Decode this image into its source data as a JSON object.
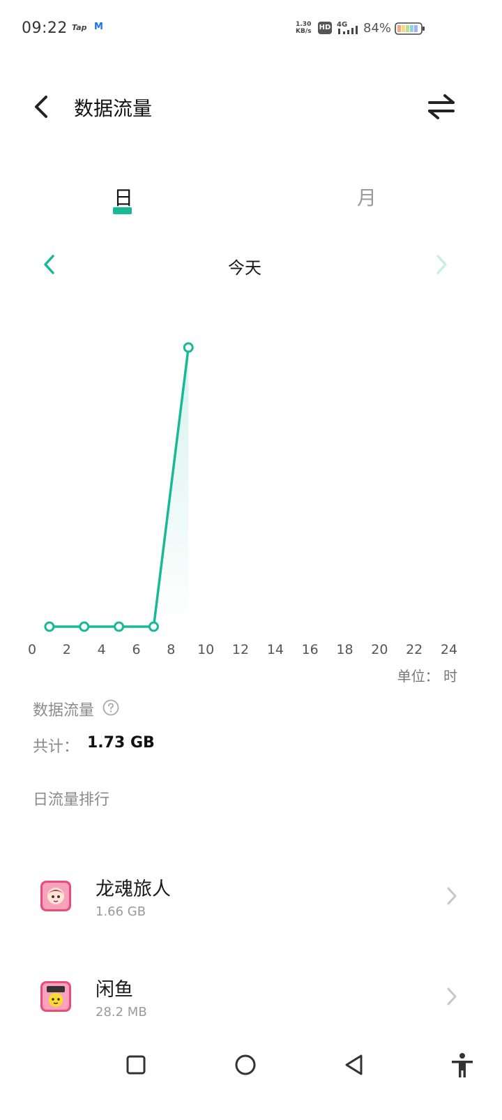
{
  "status_bar": {
    "time": "09:22",
    "app_indicators": [
      "Tap",
      "M"
    ],
    "net_speed_value": "1.30",
    "net_speed_unit": "KB/s",
    "hd_badge": "HD",
    "network": "4G",
    "battery_percent": "84%",
    "battery_level": 0.84
  },
  "header": {
    "title": "数据流量",
    "back_icon": "chevron-left-icon",
    "switch_icon": "swap-arrows-icon"
  },
  "tabs": [
    {
      "label": "日",
      "selected": true
    },
    {
      "label": "月",
      "selected": false
    }
  ],
  "date_nav": {
    "label": "今天"
  },
  "chart_data": {
    "type": "line",
    "x_ticks": [
      "0",
      "2",
      "4",
      "6",
      "8",
      "10",
      "12",
      "14",
      "16",
      "18",
      "20",
      "22",
      "24"
    ],
    "xlim": [
      0,
      24
    ],
    "points": [
      {
        "x": 1,
        "y": 0
      },
      {
        "x": 3,
        "y": 0
      },
      {
        "x": 5,
        "y": 0
      },
      {
        "x": 7,
        "y": 0
      },
      {
        "x": 9,
        "y": 1.66
      }
    ],
    "y_max": 1.66,
    "unit_label": "单位：  时",
    "line_color": "#18b996",
    "grid": false
  },
  "usage": {
    "title": "数据流量",
    "total_label": "共计：",
    "total_value": "1.73 GB"
  },
  "ranking": {
    "title": "日流量排行",
    "apps": [
      {
        "name": "龙魂旅人",
        "size": "1.66 GB"
      },
      {
        "name": "闲鱼",
        "size": "28.2 MB"
      }
    ]
  },
  "colors": {
    "accent": "#18b996",
    "text_secondary": "#8a8a8a"
  }
}
